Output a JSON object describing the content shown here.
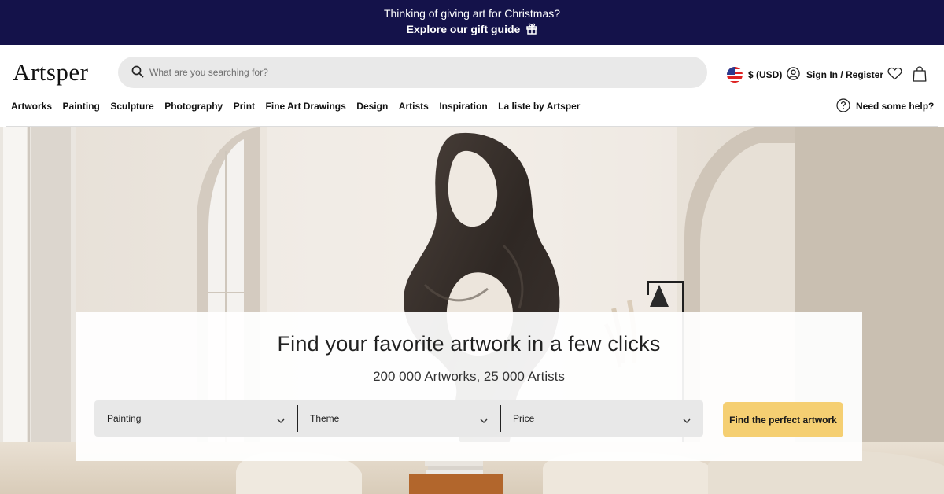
{
  "promo": {
    "line1": "Thinking of giving art for Christmas?",
    "line2": "Explore our gift guide",
    "icon": "gift-icon",
    "background": "#14124a"
  },
  "header": {
    "logo": "Artsper",
    "search": {
      "placeholder": "What are you searching for?",
      "value": "",
      "icon": "search-icon"
    },
    "currency": {
      "label": "$ (USD)",
      "icon": "us-flag-icon"
    },
    "account": {
      "label": "Sign In / Register",
      "icon": "user-icon"
    },
    "wishlist_icon": "heart-icon",
    "cart_icon": "bag-icon"
  },
  "nav": {
    "items": [
      "Artworks",
      "Painting",
      "Sculpture",
      "Photography",
      "Print",
      "Fine Art Drawings",
      "Design",
      "Artists",
      "Inspiration",
      "La liste by Artsper"
    ],
    "help": {
      "label": "Need some help?",
      "icon": "question-circle-icon"
    }
  },
  "finder": {
    "title": "Find your favorite artwork in a few clicks",
    "subtitle": "200 000 Artworks, 25 000 Artists",
    "filters": [
      {
        "label": "Painting",
        "icon": "chevron-down-icon"
      },
      {
        "label": "Theme",
        "icon": "chevron-down-icon"
      },
      {
        "label": "Price",
        "icon": "chevron-down-icon"
      }
    ],
    "cta": "Find the perfect artwork",
    "cta_color": "#f5cf72"
  }
}
